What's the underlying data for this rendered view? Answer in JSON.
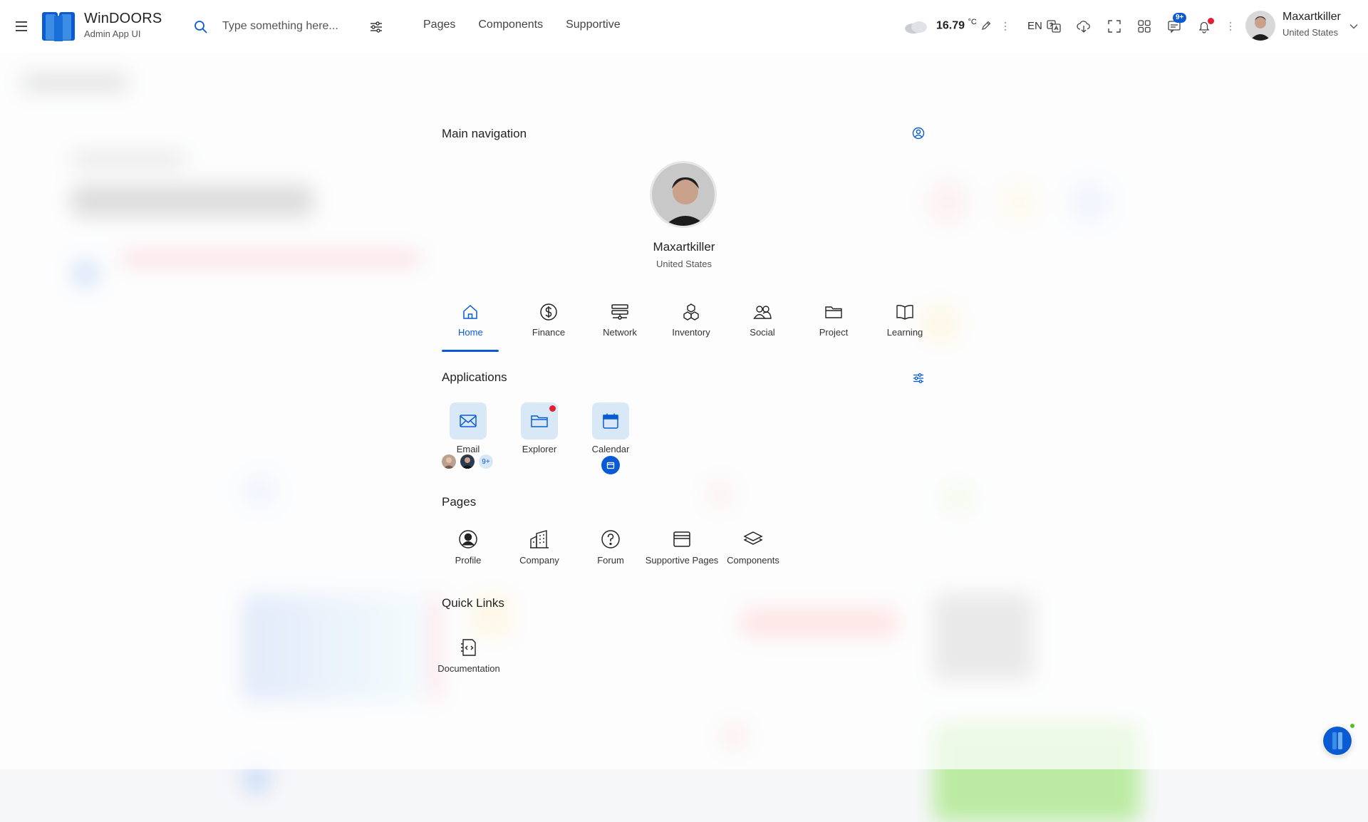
{
  "header": {
    "brand_title": "WinDOORS",
    "brand_subtitle": "Admin App UI",
    "search_placeholder": "Type something here...",
    "nav": [
      "Pages",
      "Components",
      "Supportive"
    ],
    "temperature": "16.79",
    "temperature_unit": "°C",
    "language": "EN",
    "messages_badge": "9+",
    "user_name": "Maxartkiller",
    "user_country": "United States"
  },
  "panel": {
    "title": "Main navigation",
    "profile_name": "Maxartkiller",
    "profile_country": "United States",
    "tabs": [
      {
        "label": "Home",
        "icon": "home-icon",
        "active": true
      },
      {
        "label": "Finance",
        "icon": "dollar-icon"
      },
      {
        "label": "Network",
        "icon": "network-icon"
      },
      {
        "label": "Inventory",
        "icon": "cubes-icon"
      },
      {
        "label": "Social",
        "icon": "people-icon"
      },
      {
        "label": "Project",
        "icon": "folder-icon"
      },
      {
        "label": "Learning",
        "icon": "book-icon"
      }
    ],
    "applications_title": "Applications",
    "applications": [
      {
        "label": "Email",
        "icon": "envelope-icon"
      },
      {
        "label": "Explorer",
        "icon": "folder-icon"
      },
      {
        "label": "Calendar",
        "icon": "calendar-icon"
      }
    ],
    "email_more": "9+",
    "pages_title": "Pages",
    "pages": [
      {
        "label": "Profile",
        "icon": "person-circle-icon"
      },
      {
        "label": "Company",
        "icon": "building-icon"
      },
      {
        "label": "Forum",
        "icon": "question-circle-icon"
      },
      {
        "label": "Supportive Pages",
        "icon": "window-stack-icon"
      },
      {
        "label": "Components",
        "icon": "layers-icon"
      }
    ],
    "quick_links_title": "Quick Links",
    "quick_links": [
      {
        "label": "Documentation",
        "icon": "code-file-icon"
      }
    ]
  },
  "colors": {
    "accent": "#0a5bd3",
    "tile_bg": "#d9e8f7",
    "alert": "#e51c32",
    "online": "#4fbf26"
  }
}
